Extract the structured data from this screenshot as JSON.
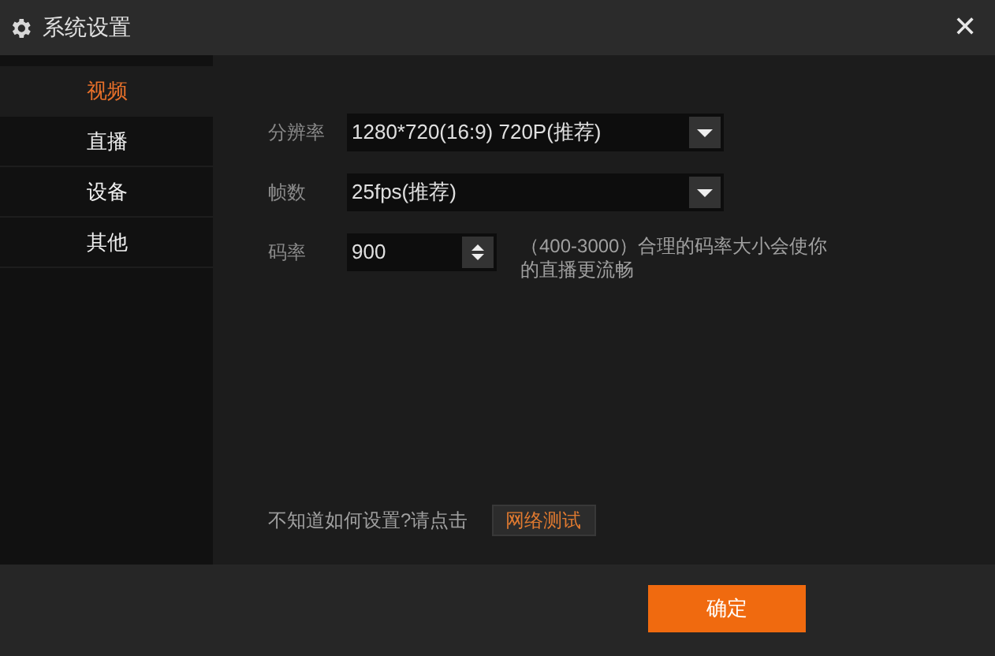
{
  "window": {
    "title": "系统设置",
    "close": "✕"
  },
  "sidebar": {
    "items": [
      {
        "label": "视频",
        "selected": true
      },
      {
        "label": "直播",
        "selected": false
      },
      {
        "label": "设备",
        "selected": false
      },
      {
        "label": "其他",
        "selected": false
      }
    ]
  },
  "form": [
    {
      "kind": "select",
      "label": "分辨率",
      "value": "1280*720(16:9) 720P(推荐)"
    },
    {
      "kind": "select",
      "label": "帧数",
      "value": "25fps(推荐)"
    },
    {
      "kind": "spinner",
      "label": "码率",
      "value": "900",
      "hint": "（400-3000）合理的码率大小会使你的直播更流畅"
    }
  ],
  "help": {
    "text": "不知道如何设置?请点击",
    "button": "网络测试"
  },
  "footer": {
    "ok": "确定"
  }
}
